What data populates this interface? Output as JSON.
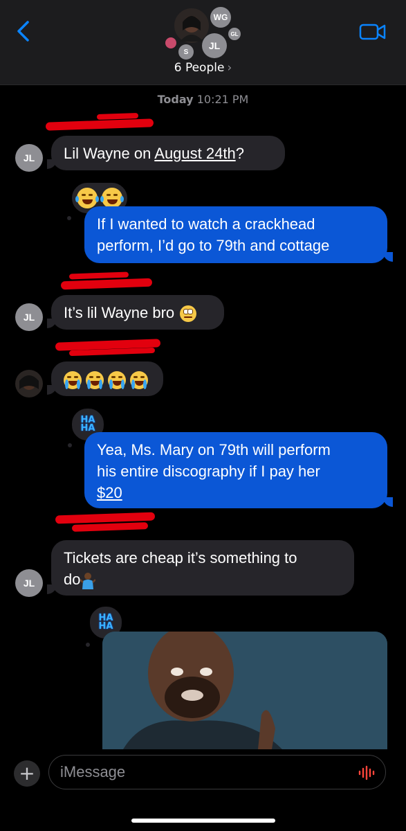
{
  "header": {
    "people_label": "6 People",
    "avatars": {
      "wg": "WG",
      "gl": "GL",
      "jl": "JL",
      "s": "S"
    }
  },
  "thread": {
    "timestamp_day": "Today",
    "timestamp_time": "10:21 PM",
    "messages": [
      {
        "from": "JL",
        "text_pre": "Lil Wayne on ",
        "text_link": "August 24th",
        "text_post": "?"
      },
      {
        "from": "me",
        "line1": "If I wanted to watch a crackhead",
        "line2": "perform, I’d go to 79th and cottage"
      },
      {
        "from": "JL",
        "text": "It’s lil Wayne bro"
      },
      {
        "from": "photo",
        "emoji_count": 4
      },
      {
        "from": "me",
        "line1": "Yea, Ms. Mary on 79th will perform",
        "line2": "his entire discography if I pay her",
        "line3_link": "$20"
      },
      {
        "from": "JL",
        "line1": "Tickets are cheap it’s something to",
        "line2": "do"
      }
    ],
    "tapback_haha": "HA HA"
  },
  "composer": {
    "placeholder": "iMessage"
  },
  "colors": {
    "outgoing": "#0b57d6",
    "incoming": "#26252a",
    "background": "#000000",
    "redaction": "#e2000e"
  },
  "icons": [
    "chevron-left-icon",
    "video-camera-icon",
    "plus-icon",
    "audio-waveform-icon"
  ]
}
